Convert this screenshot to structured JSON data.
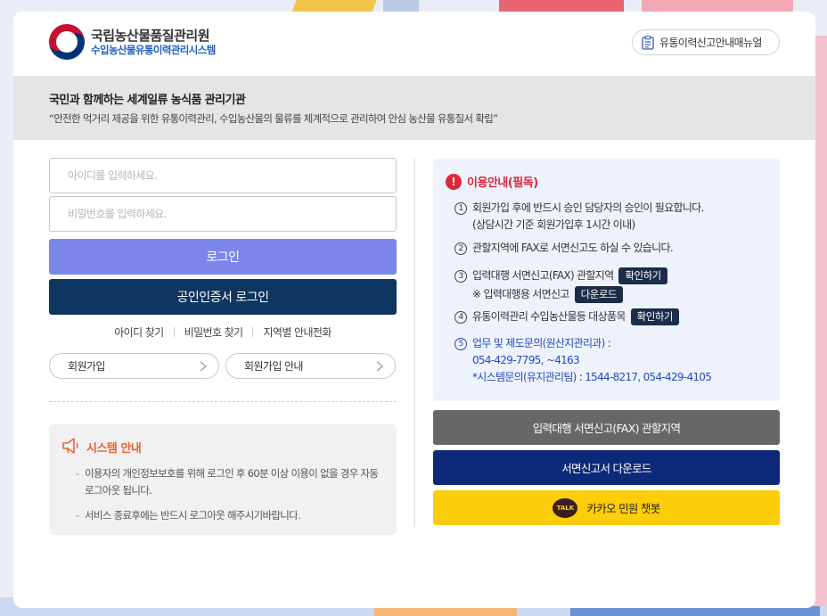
{
  "header": {
    "org_name": "국립농산물품질관리원",
    "system_name": "수입농산물유통이력관리시스템",
    "manual_button": "유통이력신고안내매뉴얼"
  },
  "banner": {
    "title": "국민과 함께하는 세계일류 농식품 관리기관",
    "subtitle": "“안전한 먹거리 제공을 위한 유통이력관리, 수입농산물의 물류를 체계적으로 관리하여 안심 농산물 유통질서 확립”"
  },
  "login": {
    "id_placeholder": "아이디를 입력하세요.",
    "pw_placeholder": "비밀번호를 입력하세요.",
    "login_button": "로그인",
    "cert_login_button": "공인인증서 로그인",
    "find_links": [
      "아이디 찾기",
      "비밀번호 찾기",
      "지역별 안내전화"
    ],
    "signup_button": "회원가입",
    "signup_guide_button": "회원가입 안내"
  },
  "system_notice": {
    "title": "시스템 안내",
    "items": [
      "이용자의 개인정보보호를 위해 로그인 후 60분 이상 이용이 없을 경우 자동 로그아웃 됩니다.",
      "서비스 종료후에는 반드시 로그아웃 해주시기바랍니다."
    ]
  },
  "usage_guide": {
    "title": "이용안내(필독)",
    "item1_line1": "회원가입 후에 반드시 승인 담당자의 승인이 필요합니다.",
    "item1_line2": "(상담시간 기준 회원가입후 1시간 이내)",
    "item2": "관할지역에 FAX로 서면신고도 하실 수 있습니다.",
    "item3_line1": "입력대행 서면신고(FAX) 관할지역",
    "item3_tag": "확인하기",
    "item3_line2": "※ 입력대행용 서면신고",
    "item3_tag2": "다운로드",
    "item4": "유통이력관리 수입농산물등 대상품목",
    "item4_tag": "확인하기",
    "item5_line1": "업무 및 제도문의(원산지관리과) :",
    "item5_line2": "054-429-7795, ~4163",
    "item5_line3": "*시스템문의(유지관리팀) : 1544-8217,  054-429-4105",
    "nums": [
      "1",
      "2",
      "3",
      "4",
      "5"
    ]
  },
  "right_buttons": {
    "fax_region": "입력대행 서면신고(FAX) 관할지역",
    "download": "서면신고서 다운로드",
    "kakao": "카카오 민원 챗봇",
    "kakao_icon_text": "TALK"
  }
}
